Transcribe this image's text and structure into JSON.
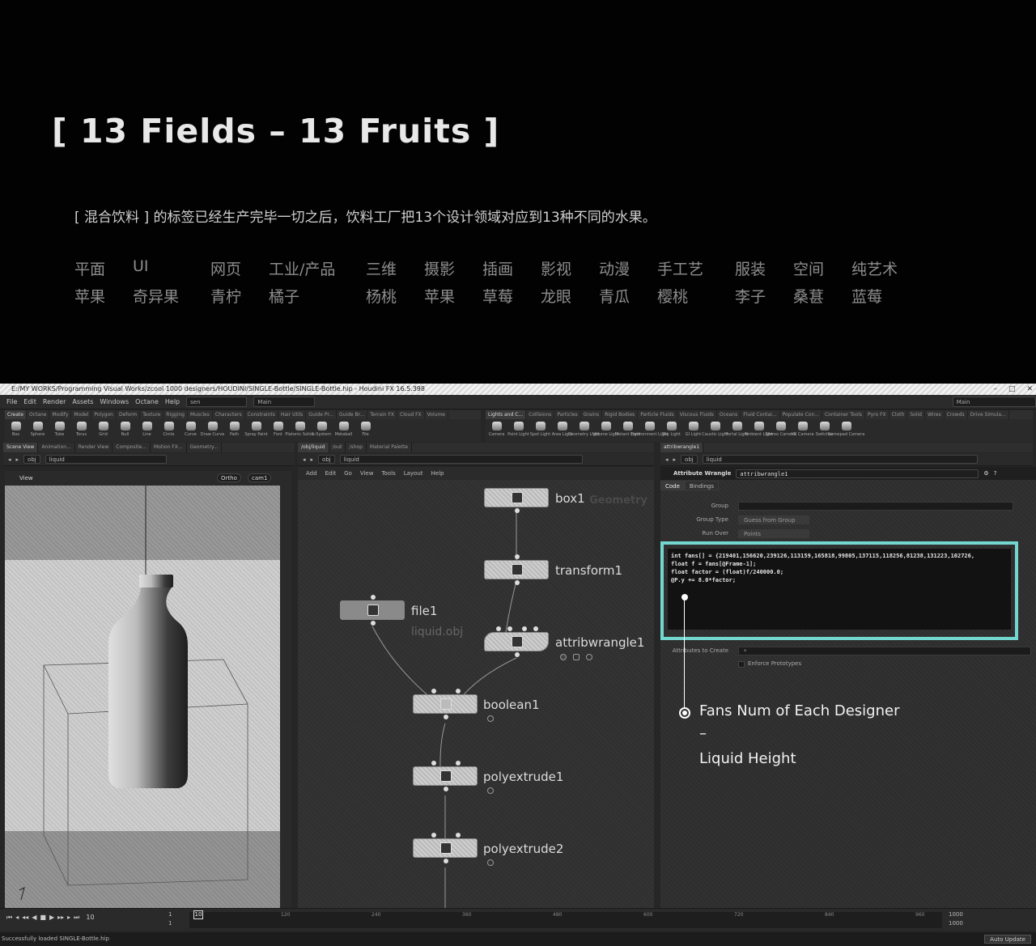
{
  "header": {
    "title": "[ 13 Fields – 13 Fruits ]",
    "description": "[ 混合饮料 ] 的标签已经生产完毕一切之后，饮料工厂把13个设计领域对应到13种不同的水果。",
    "fields": [
      "平面",
      "UI",
      "网页",
      "工业/产品",
      "三维",
      "摄影",
      "插画",
      "影视",
      "动漫",
      "手工艺",
      "服装",
      "空间",
      "纯艺术"
    ],
    "fruits": [
      "苹果",
      "奇异果",
      "青柠",
      "橘子",
      "杨桃",
      "苹果",
      "草莓",
      "龙眼",
      "青瓜",
      "樱桃",
      "李子",
      "桑葚",
      "蓝莓"
    ]
  },
  "app": {
    "window_title": "E:/MY WORKS/Programming Visual Works/zcool 1000 designers/HOUDINI/SINGLE-Bottle/SINGLE-Bottle.hip - Houdini FX 16.5.398",
    "menu": [
      "File",
      "Edit",
      "Render",
      "Assets",
      "Windows",
      "Octane",
      "Help"
    ],
    "desktop_left": "sen",
    "desktop_mid": "Main",
    "desktop_right": "Main",
    "shelf_tabs_left": [
      "Create",
      "Octane",
      "Modify",
      "Model",
      "Polygon",
      "Deform",
      "Texture",
      "Rigging",
      "Muscles",
      "Characters",
      "Constraints",
      "Hair Utils",
      "Guide Pr...",
      "Guide Br...",
      "Terrain FX",
      "Cloud FX",
      "Volume"
    ],
    "shelf_tabs_right": [
      "Lights and C...",
      "Collisions",
      "Particles",
      "Grains",
      "Rigid Bodies",
      "Particle Fluids",
      "Viscous Fluids",
      "Oceans",
      "Fluid Contai...",
      "Populate Con...",
      "Container Tools",
      "Pyro FX",
      "Cloth",
      "Solid",
      "Wires",
      "Crowds",
      "Drive Simula..."
    ],
    "tools_left": [
      "Box",
      "Sphere",
      "Tube",
      "Torus",
      "Grid",
      "Null",
      "Line",
      "Circle",
      "Curve",
      "Draw Curve",
      "Path",
      "Spray Paint",
      "Font",
      "Platonic Solids",
      "L-System",
      "Metaball",
      "File"
    ],
    "tools_right": [
      "Camera",
      "Point Light",
      "Spot Light",
      "Area Light",
      "Geometry Light",
      "Volume Light",
      "Distant Light",
      "Environment Light",
      "Sky Light",
      "GI Light",
      "Caustic Light",
      "Portal Light",
      "Ambient Light",
      "Stereo Camera",
      "VR Camera",
      "Switcher",
      "Gamepad Camera"
    ],
    "left_panel_tabs": [
      "Scene View",
      "Animation...",
      "Render View",
      "Composite...",
      "Motion FX...",
      "Geometry..."
    ],
    "mid_panel_tabs": [
      "/obj/liquid",
      "/out",
      "/shop",
      "Material Palette"
    ],
    "right_panel_tabs": [
      "attribwrangle1"
    ],
    "path_obj": "obj",
    "path_node": "liquid",
    "viewport": {
      "label": "View",
      "shading": "Ortho",
      "camera": "cam1"
    },
    "network": {
      "menu": [
        "Add",
        "Edit",
        "Go",
        "View",
        "Tools",
        "Layout",
        "Help"
      ],
      "context_label": "Geometry",
      "nodes": [
        {
          "name": "box1",
          "sub": ""
        },
        {
          "name": "transform1",
          "sub": ""
        },
        {
          "name": "file1",
          "sub": "liquid.obj"
        },
        {
          "name": "attribwrangle1",
          "sub": ""
        },
        {
          "name": "boolean1",
          "sub": ""
        },
        {
          "name": "polyextrude1",
          "sub": ""
        },
        {
          "name": "polyextrude2",
          "sub": ""
        }
      ]
    },
    "params": {
      "node_type": "Attribute Wrangle",
      "node_name": "attribwrangle1",
      "tabs": [
        "Code",
        "Bindings"
      ],
      "group_label": "Group",
      "group_value": "",
      "group_type_label": "Group Type",
      "group_type_value": "Guess from Group",
      "run_over_label": "Run Over",
      "run_over_value": "Points",
      "code_lines": [
        "int fans[] = {219401,156620,239126,113159,165818,99805,137115,118256,81238,131223,102726,",
        "float f = fans[@Frame-1];",
        "float factor = (float)f/240000.0;",
        "@P.y += 8.0*factor;"
      ],
      "attrs_create_label": "Attributes to Create",
      "attrs_create_value": "*",
      "enforce_label": "Enforce Prototypes"
    },
    "annotation": {
      "line1": "Fans Num of Each Designer",
      "line2": "–",
      "line3": "Liquid Height"
    },
    "timeline": {
      "current_frame": "10",
      "start": "1",
      "start2": "1",
      "ticks": [
        "120",
        "240",
        "360",
        "480",
        "600",
        "720",
        "840",
        "960"
      ],
      "end": "1000",
      "end2": "1000"
    },
    "status": "Successfully loaded SINGLE-Bottle.hip",
    "auto_update": "Auto Update"
  }
}
